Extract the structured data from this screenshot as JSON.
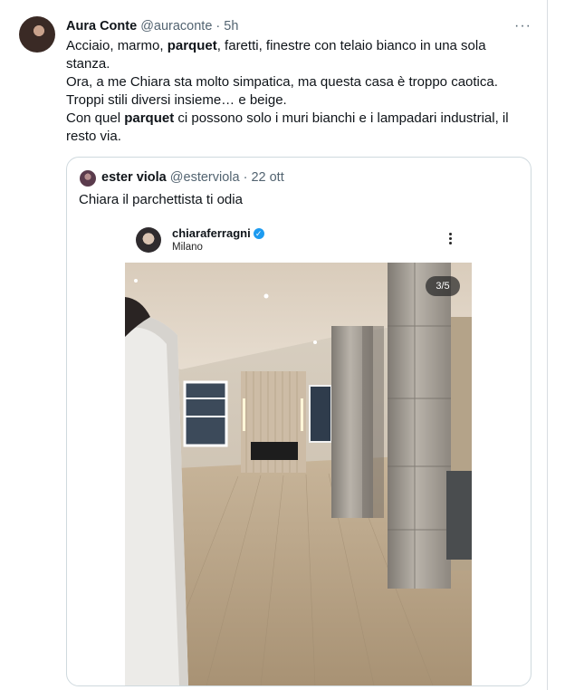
{
  "tweet": {
    "display_name": "Aura Conte",
    "handle": "@auraconte",
    "separator": " · ",
    "time": "5h",
    "more_label": "···",
    "line1_a": "Acciaio, marmo, ",
    "line1_bold": "parquet",
    "line1_b": ", faretti, finestre con telaio bianco in una sola stanza.",
    "line2": "Ora, a me Chiara sta molto simpatica, ma questa casa è troppo caotica.",
    "line3": "Troppi stili diversi insieme… e beige.",
    "line4_a": "Con quel ",
    "line4_bold": "parquet",
    "line4_b": " ci possono solo i muri bianchi e i lampadari industrial, il resto via."
  },
  "quote": {
    "display_name": "ester viola",
    "handle": "@esterviola",
    "separator": " · ",
    "date": "22 ott",
    "text": "Chiara il parchettista ti odia"
  },
  "instagram": {
    "username": "chiaraferragni",
    "verified_mark": "✓",
    "location": "Milano",
    "counter": "3/5"
  },
  "colors": {
    "text": "#0f1419",
    "muted": "#536471",
    "border": "#cfd9de",
    "verified": "#1d9bf0"
  },
  "icons": [
    "more-icon",
    "verified-icon",
    "ig-more-icon"
  ]
}
